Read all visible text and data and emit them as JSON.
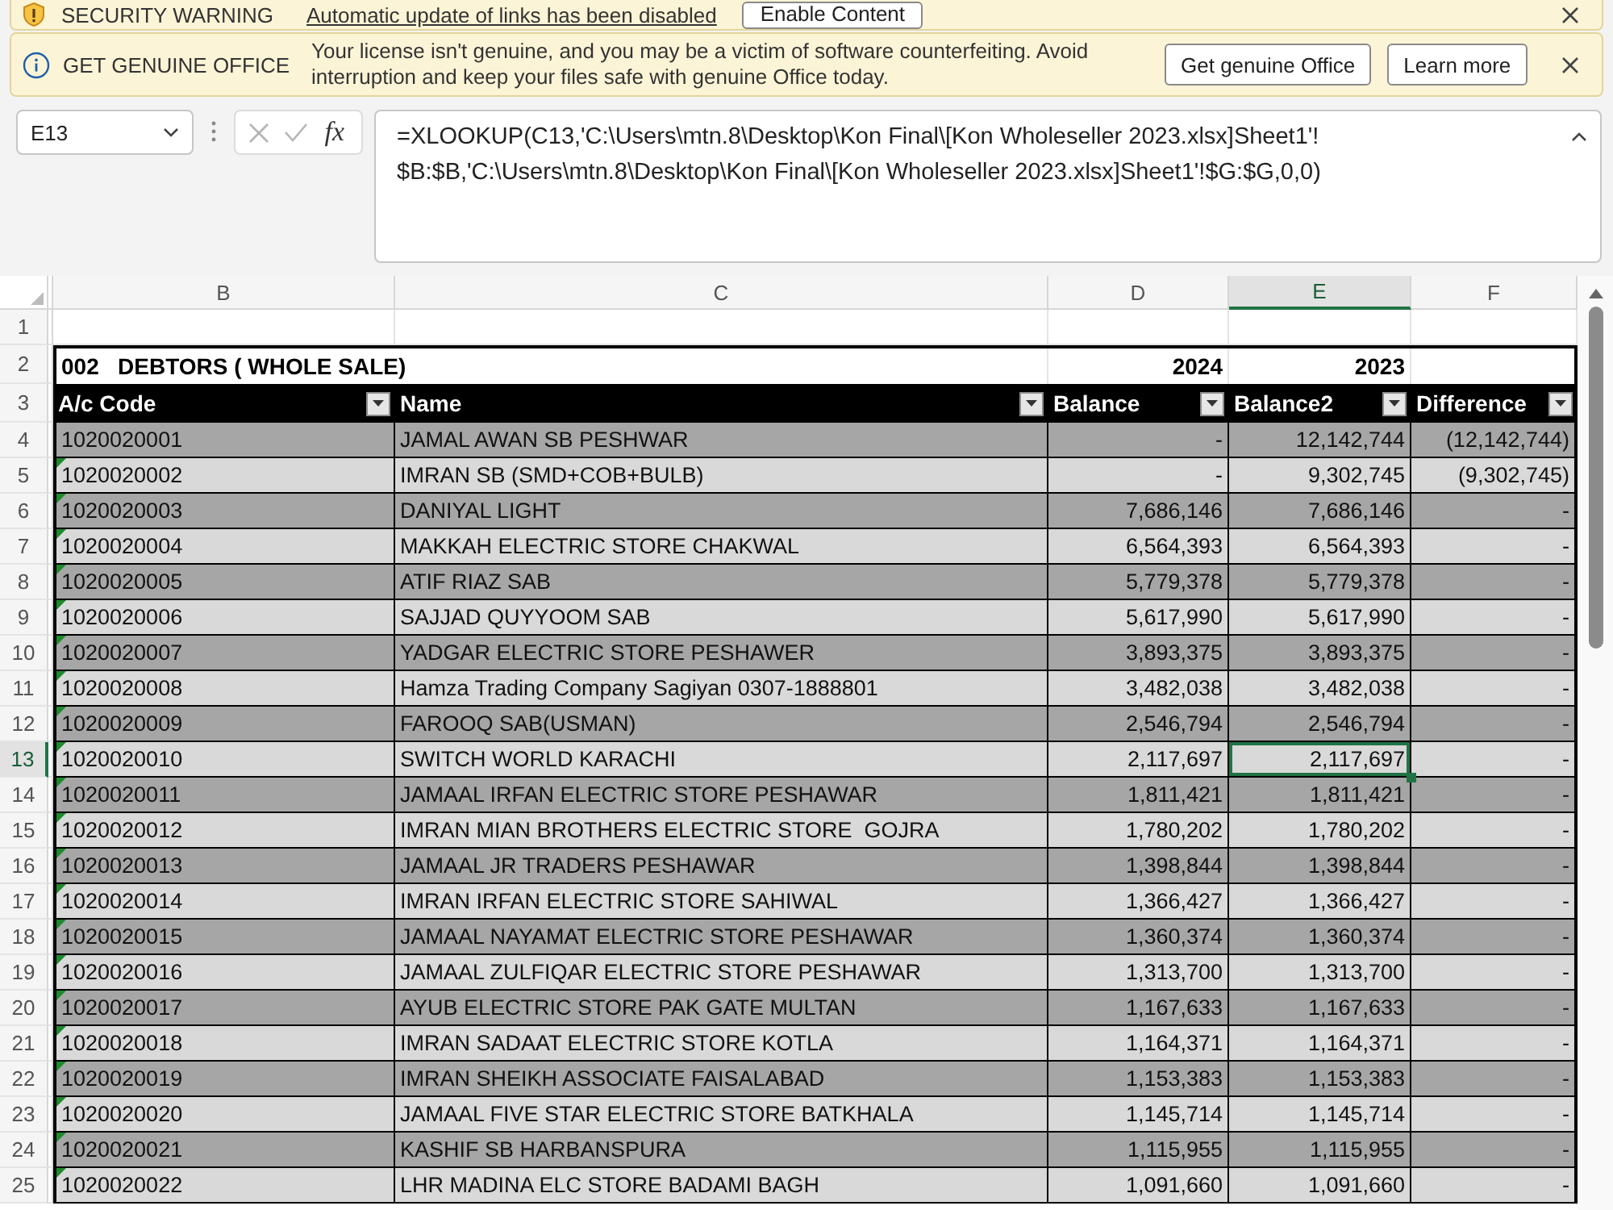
{
  "security_bar": {
    "title": "SECURITY WARNING",
    "link": "Automatic update of links has been disabled",
    "button": "Enable Content"
  },
  "license_bar": {
    "title": "GET GENUINE OFFICE",
    "message": "Your license isn't genuine, and you may be a victim of software counterfeiting. Avoid interruption and keep your files safe with genuine Office today.",
    "buttons": [
      "Get genuine Office",
      "Learn more"
    ]
  },
  "formula_bar": {
    "name_box": "E13",
    "editing": false,
    "function_button": "fx",
    "formula": "=XLOOKUP(C13,'C:\\Users\\mtn.8\\Desktop\\Kon Final\\[Kon Wholeseller 2023.xlsx]Sheet1'!$B:$B,'C:\\Users\\mtn.8\\Desktop\\Kon Final\\[Kon Wholeseller 2023.xlsx]Sheet1'!$G:$G,0,0)"
  },
  "sheet": {
    "columns": [
      {
        "label": "B",
        "selected": false
      },
      {
        "label": "C",
        "selected": false
      },
      {
        "label": "D",
        "selected": false
      },
      {
        "label": "E",
        "selected": true
      },
      {
        "label": "F",
        "selected": false
      }
    ],
    "rows": [
      {
        "kind": "blank",
        "row_number": "1",
        "selected": false
      },
      {
        "kind": "title",
        "row_number": "2",
        "selected": false,
        "title": "002   DEBTORS ( WHOLE SALE)",
        "year_1": "2024",
        "year_2": "2023"
      },
      {
        "kind": "header",
        "row_number": "3",
        "selected": false,
        "cells": [
          "A/c Code",
          "Name",
          "Balance",
          "Balance2",
          "Difference"
        ]
      },
      {
        "kind": "data",
        "row_number": "4",
        "selected": false,
        "flagged": false,
        "cells": [
          "1020020001",
          "JAMAL AWAN SB PESHWAR",
          "-",
          "12,142,744",
          "(12,142,744)"
        ]
      },
      {
        "kind": "data",
        "row_number": "5",
        "selected": false,
        "flagged": true,
        "cells": [
          "1020020002",
          "IMRAN SB (SMD+COB+BULB)",
          "-",
          "9,302,745",
          "(9,302,745)"
        ]
      },
      {
        "kind": "data",
        "row_number": "6",
        "selected": false,
        "flagged": true,
        "cells": [
          "1020020003",
          "DANIYAL LIGHT",
          "7,686,146",
          "7,686,146",
          "-"
        ]
      },
      {
        "kind": "data",
        "row_number": "7",
        "selected": false,
        "flagged": true,
        "cells": [
          "1020020004",
          "MAKKAH ELECTRIC STORE CHAKWAL",
          "6,564,393",
          "6,564,393",
          "-"
        ]
      },
      {
        "kind": "data",
        "row_number": "8",
        "selected": false,
        "flagged": true,
        "cells": [
          "1020020005",
          "ATIF RIAZ SAB",
          "5,779,378",
          "5,779,378",
          "-"
        ]
      },
      {
        "kind": "data",
        "row_number": "9",
        "selected": false,
        "flagged": true,
        "cells": [
          "1020020006",
          "SAJJAD QUYYOOM SAB",
          "5,617,990",
          "5,617,990",
          "-"
        ]
      },
      {
        "kind": "data",
        "row_number": "10",
        "selected": false,
        "flagged": true,
        "cells": [
          "1020020007",
          "YADGAR ELECTRIC STORE PESHAWER",
          "3,893,375",
          "3,893,375",
          "-"
        ]
      },
      {
        "kind": "data",
        "row_number": "11",
        "selected": false,
        "flagged": true,
        "cells": [
          "1020020008",
          "Hamza Trading Company Sagiyan 0307-1888801",
          "3,482,038",
          "3,482,038",
          "-"
        ]
      },
      {
        "kind": "data",
        "row_number": "12",
        "selected": false,
        "flagged": true,
        "cells": [
          "1020020009",
          "FAROOQ SAB(USMAN)",
          "2,546,794",
          "2,546,794",
          "-"
        ]
      },
      {
        "kind": "data",
        "row_number": "13",
        "selected": true,
        "flagged": true,
        "cells": [
          "1020020010",
          "SWITCH WORLD KARACHI",
          "2,117,697",
          "2,117,697",
          "-"
        ]
      },
      {
        "kind": "data",
        "row_number": "14",
        "selected": false,
        "flagged": true,
        "cells": [
          "1020020011",
          "JAMAAL IRFAN ELECTRIC STORE PESHAWAR",
          "1,811,421",
          "1,811,421",
          "-"
        ]
      },
      {
        "kind": "data",
        "row_number": "15",
        "selected": false,
        "flagged": true,
        "cells": [
          "1020020012",
          "IMRAN MIAN BROTHERS ELECTRIC STORE  GOJRA",
          "1,780,202",
          "1,780,202",
          "-"
        ]
      },
      {
        "kind": "data",
        "row_number": "16",
        "selected": false,
        "flagged": true,
        "cells": [
          "1020020013",
          "JAMAAL JR TRADERS PESHAWAR",
          "1,398,844",
          "1,398,844",
          "-"
        ]
      },
      {
        "kind": "data",
        "row_number": "17",
        "selected": false,
        "flagged": true,
        "cells": [
          "1020020014",
          "IMRAN IRFAN ELECTRIC STORE SAHIWAL",
          "1,366,427",
          "1,366,427",
          "-"
        ]
      },
      {
        "kind": "data",
        "row_number": "18",
        "selected": false,
        "flagged": true,
        "cells": [
          "1020020015",
          "JAMAAL NAYAMAT ELECTRIC STORE PESHAWAR",
          "1,360,374",
          "1,360,374",
          "-"
        ]
      },
      {
        "kind": "data",
        "row_number": "19",
        "selected": false,
        "flagged": true,
        "cells": [
          "1020020016",
          "JAMAAL ZULFIQAR ELECTRIC STORE PESHAWAR",
          "1,313,700",
          "1,313,700",
          "-"
        ]
      },
      {
        "kind": "data",
        "row_number": "20",
        "selected": false,
        "flagged": true,
        "cells": [
          "1020020017",
          "AYUB ELECTRIC STORE PAK GATE MULTAN",
          "1,167,633",
          "1,167,633",
          "-"
        ]
      },
      {
        "kind": "data",
        "row_number": "21",
        "selected": false,
        "flagged": true,
        "cells": [
          "1020020018",
          "IMRAN SADAAT ELECTRIC STORE KOTLA",
          "1,164,371",
          "1,164,371",
          "-"
        ]
      },
      {
        "kind": "data",
        "row_number": "22",
        "selected": false,
        "flagged": true,
        "cells": [
          "1020020019",
          "IMRAN SHEIKH ASSOCIATE FAISALABAD",
          "1,153,383",
          "1,153,383",
          "-"
        ]
      },
      {
        "kind": "data",
        "row_number": "23",
        "selected": false,
        "flagged": true,
        "cells": [
          "1020020020",
          "JAMAAL FIVE STAR ELECTRIC STORE BATKHALA",
          "1,145,714",
          "1,145,714",
          "-"
        ]
      },
      {
        "kind": "data",
        "row_number": "24",
        "selected": false,
        "flagged": true,
        "cells": [
          "1020020021",
          "KASHIF SB HARBANSPURA",
          "1,115,955",
          "1,115,955",
          "-"
        ]
      },
      {
        "kind": "data",
        "row_number": "25",
        "selected": false,
        "flagged": true,
        "cells": [
          "1020020022",
          "LHR MADINA ELC STORE BADAMI BAGH",
          "1,091,660",
          "1,091,660",
          "-"
        ]
      }
    ]
  }
}
